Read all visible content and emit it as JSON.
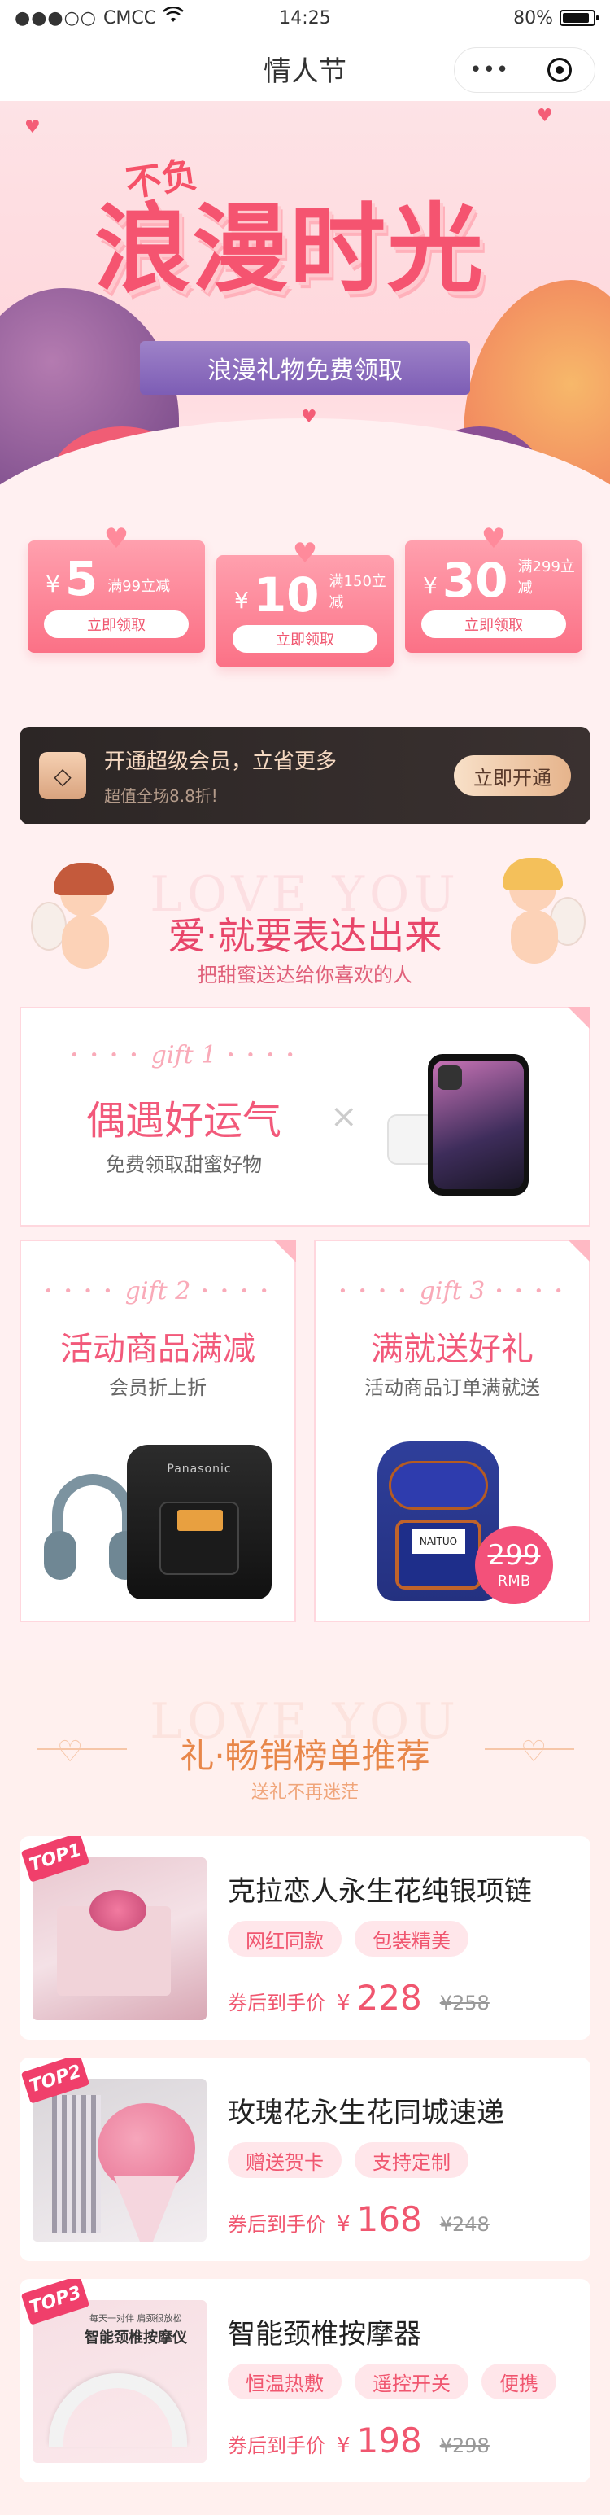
{
  "status_bar": {
    "carrier": "CMCC",
    "time": "14:25",
    "battery": "80%"
  },
  "nav": {
    "title": "情人节"
  },
  "hero": {
    "prefix": "不负",
    "title": "浪漫时光",
    "ribbon": "浪漫礼物免费领取"
  },
  "coupons": [
    {
      "currency": "¥",
      "amount": "5",
      "condition": "满99立减",
      "button": "立即领取"
    },
    {
      "currency": "¥",
      "amount": "10",
      "condition": "满150立减",
      "button": "立即领取"
    },
    {
      "currency": "¥",
      "amount": "30",
      "condition": "满299立减",
      "button": "立即领取"
    }
  ],
  "vip": {
    "title": "开通超级会员，立省更多",
    "subtitle": "超值全场8.8折!",
    "button": "立即开通"
  },
  "love_section": {
    "ghost": "LOVE YOU",
    "title": "爱·就要表达出来",
    "subtitle": "把甜蜜送达给你喜欢的人"
  },
  "gift1": {
    "label": "gift 1",
    "title": "偶遇好运气",
    "desc": "免费领取甜蜜好物",
    "times": "×"
  },
  "gift2": {
    "label": "gift 2",
    "title": "活动商品满减",
    "desc": "会员折上折",
    "cooker_brand": "Panasonic"
  },
  "gift3": {
    "label": "gift 3",
    "title": "满就送好礼",
    "desc": "活动商品订单满就送",
    "backpack_tag": "NAITUO",
    "price": "299",
    "price_unit": "RMB"
  },
  "rank_section": {
    "ghost": "LOVE YOU",
    "title": "礼·畅销榜单推荐",
    "subtitle": "送礼不再迷茫"
  },
  "ranking": [
    {
      "badge": "TOP1",
      "name": "克拉恋人永生花纯银项链",
      "tags": [
        "网红同款",
        "包装精美"
      ],
      "price_label": "券后到手价",
      "currency": "¥",
      "price": "228",
      "original": "¥258"
    },
    {
      "badge": "TOP2",
      "name": "玫瑰花永生花同城速递",
      "tags": [
        "赠送贺卡",
        "支持定制"
      ],
      "price_label": "券后到手价",
      "currency": "¥",
      "price": "168",
      "original": "¥248"
    },
    {
      "badge": "TOP3",
      "name": "智能颈椎按摩器",
      "tags": [
        "恒温热敷",
        "遥控开关",
        "便携"
      ],
      "price_label": "券后到手价",
      "currency": "¥",
      "price": "198",
      "original": "¥298",
      "thumb_caption_small": "每天一对伴 肩颈很放松",
      "thumb_caption": "智能颈椎按摩仪"
    }
  ],
  "colors": {
    "accent": "#f0566f",
    "coupon": "#fb7186",
    "vip_bg": "#2c2625",
    "rank_accent": "#e8874a"
  }
}
